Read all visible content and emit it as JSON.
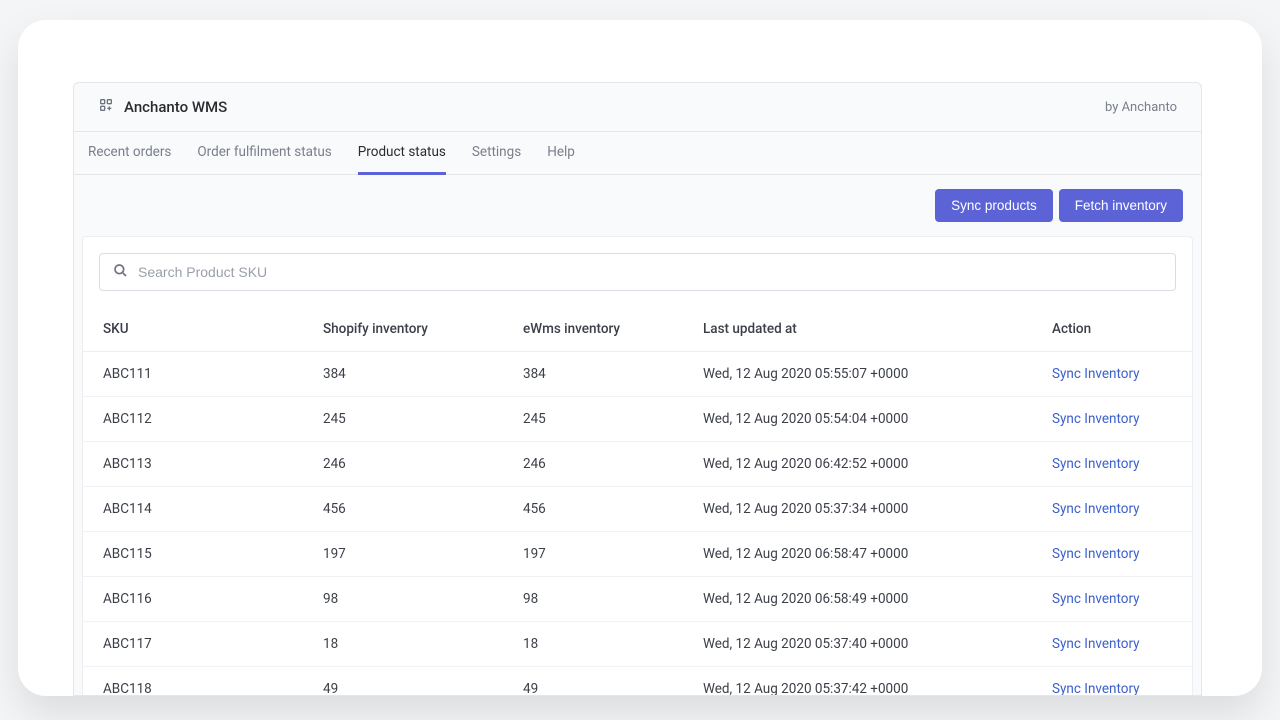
{
  "header": {
    "title": "Anchanto WMS",
    "byline": "by Anchanto"
  },
  "tabs": [
    {
      "label": "Recent orders",
      "active": false
    },
    {
      "label": "Order fulfilment status",
      "active": false
    },
    {
      "label": "Product status",
      "active": true
    },
    {
      "label": "Settings",
      "active": false
    },
    {
      "label": "Help",
      "active": false
    }
  ],
  "actions": {
    "sync_products": "Sync products",
    "fetch_inventory": "Fetch inventory"
  },
  "search": {
    "placeholder": "Search Product SKU"
  },
  "table": {
    "columns": {
      "sku": "SKU",
      "shopify": "Shopify inventory",
      "ewms": "eWms inventory",
      "updated": "Last updated at",
      "action": "Action"
    },
    "action_label": "Sync Inventory",
    "rows": [
      {
        "sku": "ABC111",
        "shopify": "384",
        "ewms": "384",
        "updated": "Wed, 12 Aug 2020 05:55:07 +0000"
      },
      {
        "sku": "ABC112",
        "shopify": "245",
        "ewms": "245",
        "updated": "Wed, 12 Aug 2020 05:54:04 +0000"
      },
      {
        "sku": "ABC113",
        "shopify": "246",
        "ewms": "246",
        "updated": "Wed, 12 Aug 2020 06:42:52 +0000"
      },
      {
        "sku": "ABC114",
        "shopify": "456",
        "ewms": "456",
        "updated": "Wed, 12 Aug 2020 05:37:34 +0000"
      },
      {
        "sku": "ABC115",
        "shopify": "197",
        "ewms": "197",
        "updated": "Wed, 12 Aug 2020 06:58:47 +0000"
      },
      {
        "sku": "ABC116",
        "shopify": "98",
        "ewms": "98",
        "updated": "Wed, 12 Aug 2020 06:58:49 +0000"
      },
      {
        "sku": "ABC117",
        "shopify": "18",
        "ewms": "18",
        "updated": "Wed, 12 Aug 2020 05:37:40 +0000"
      },
      {
        "sku": "ABC118",
        "shopify": "49",
        "ewms": "49",
        "updated": "Wed, 12 Aug 2020 05:37:42 +0000"
      }
    ]
  }
}
